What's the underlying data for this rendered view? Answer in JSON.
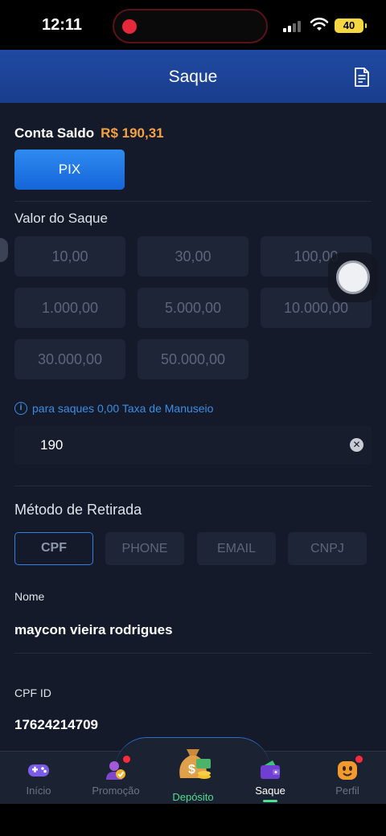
{
  "status_bar": {
    "time": "12:11",
    "battery": "40"
  },
  "header": {
    "title": "Saque"
  },
  "balance": {
    "label": "Conta Saldo",
    "value": "R$ 190,31"
  },
  "pix_button": "PIX",
  "withdraw_section": {
    "label": "Valor do Saque",
    "amounts": [
      "10,00",
      "30,00",
      "100,00",
      "1.000,00",
      "5.000,00",
      "10.000,00",
      "30.000,00",
      "50.000,00"
    ]
  },
  "info": {
    "icon": "info-icon",
    "text": "para saques 0,00 Taxa de Manuseio"
  },
  "amount_input": {
    "value": "190"
  },
  "method_section": {
    "label": "Método de Retirada",
    "tabs": [
      "CPF",
      "PHONE",
      "EMAIL",
      "CNPJ"
    ],
    "selected": "CPF"
  },
  "fields": {
    "name_label": "Nome",
    "name_value": "maycon vieira rodrigues",
    "cpf_label": "CPF ID",
    "cpf_value": "17624214709"
  },
  "bottom_nav": {
    "items": [
      {
        "label": "Início",
        "icon": "gamepad-icon"
      },
      {
        "label": "Promoção",
        "icon": "promo-user-icon"
      },
      {
        "label": "Depósito",
        "icon": "money-bag-icon"
      },
      {
        "label": "Saque",
        "icon": "wallet-icon"
      },
      {
        "label": "Perfil",
        "icon": "profile-face-icon"
      }
    ],
    "active": "Saque"
  },
  "colors": {
    "accent_blue": "#1f4aa3",
    "balance_orange": "#f5a142",
    "active_green": "#4dde8f",
    "info_blue": "#3b8ee6"
  }
}
